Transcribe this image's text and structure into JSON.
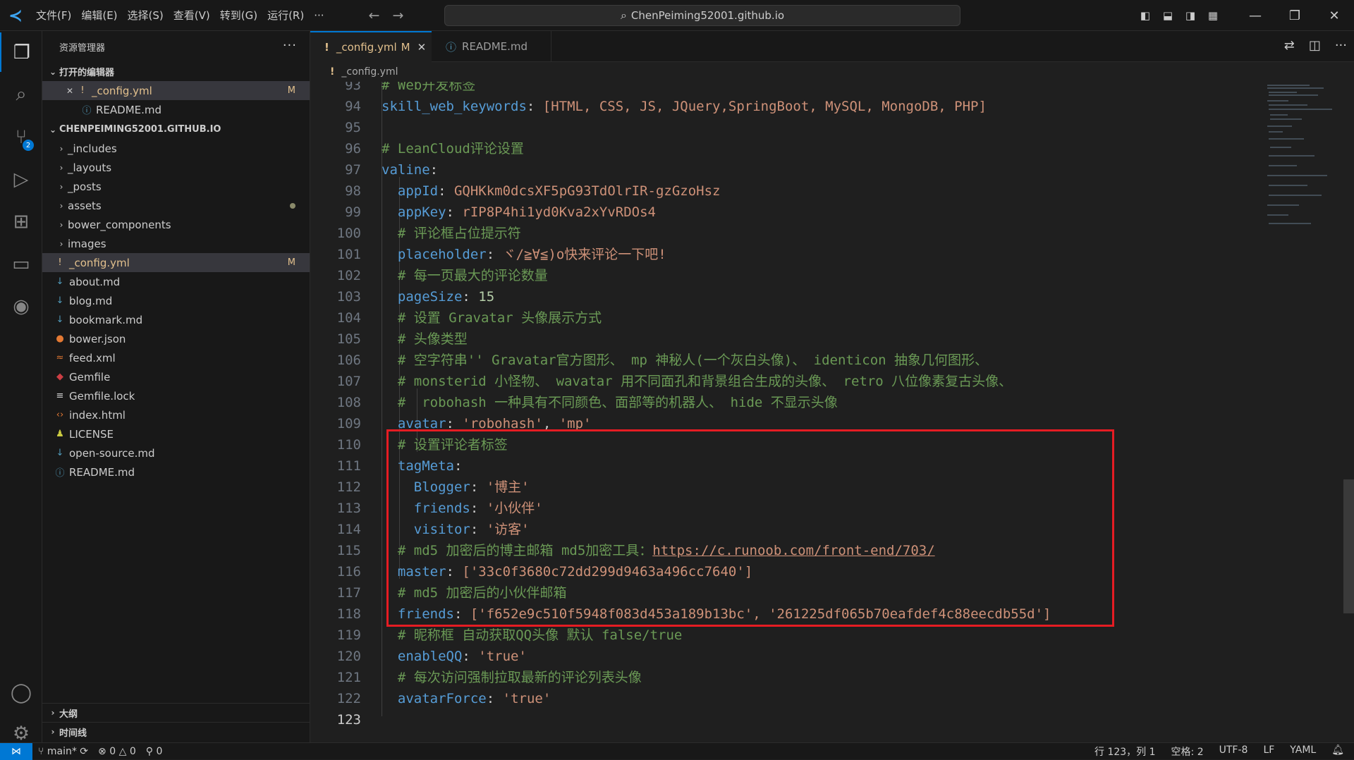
{
  "menu": [
    "文件(F)",
    "编辑(E)",
    "选择(S)",
    "查看(V)",
    "转到(G)",
    "运行(R)",
    "···"
  ],
  "search": {
    "text": "ChenPeiming52001.github.io"
  },
  "sidebar": {
    "title": "资源管理器",
    "open_editors_header": "打开的编辑器",
    "open_editors": [
      {
        "name": "_config.yml",
        "badge": "M"
      },
      {
        "name": "README.md"
      }
    ],
    "workspace_header": "CHENPEIMING52001.GITHUB.IO",
    "folders": [
      "_includes",
      "_layouts",
      "_posts",
      "assets",
      "bower_components",
      "images"
    ],
    "files": [
      {
        "name": "_config.yml",
        "badge": "M"
      },
      {
        "name": "about.md"
      },
      {
        "name": "blog.md"
      },
      {
        "name": "bookmark.md"
      },
      {
        "name": "bower.json"
      },
      {
        "name": "feed.xml"
      },
      {
        "name": "Gemfile"
      },
      {
        "name": "Gemfile.lock"
      },
      {
        "name": "index.html"
      },
      {
        "name": "LICENSE"
      },
      {
        "name": "open-source.md"
      },
      {
        "name": "README.md"
      }
    ],
    "outline": "大纲",
    "timeline": "时间线"
  },
  "tabs": [
    {
      "label": "_config.yml",
      "modified": "M"
    },
    {
      "label": "README.md"
    }
  ],
  "breadcrumb": "_config.yml",
  "code_lines": [
    {
      "n": "93",
      "segs": [
        [
          "c",
          "# Web开发标签"
        ]
      ]
    },
    {
      "n": "94",
      "segs": [
        [
          "k",
          "skill_web_keywords"
        ],
        [
          "p",
          ": "
        ],
        [
          "s",
          "[HTML, CSS, JS, JQuery,SpringBoot, MySQL, MongoDB, PHP]"
        ]
      ]
    },
    {
      "n": "95",
      "segs": []
    },
    {
      "n": "96",
      "segs": [
        [
          "c",
          "# LeanCloud评论设置"
        ]
      ]
    },
    {
      "n": "97",
      "segs": [
        [
          "k",
          "valine"
        ],
        [
          "p",
          ":"
        ]
      ]
    },
    {
      "n": "98",
      "segs": [
        [
          "p",
          "  "
        ],
        [
          "k",
          "appId"
        ],
        [
          "p",
          ": "
        ],
        [
          "s",
          "GQHKkm0dcsXF5pG93TdOlrIR-gzGzoHsz"
        ]
      ]
    },
    {
      "n": "99",
      "segs": [
        [
          "p",
          "  "
        ],
        [
          "k",
          "appKey"
        ],
        [
          "p",
          ": "
        ],
        [
          "s",
          "rIP8P4hi1yd0Kva2xYvRDOs4"
        ]
      ]
    },
    {
      "n": "100",
      "segs": [
        [
          "p",
          "  "
        ],
        [
          "c",
          "# 评论框占位提示符"
        ]
      ]
    },
    {
      "n": "101",
      "segs": [
        [
          "p",
          "  "
        ],
        [
          "k",
          "placeholder"
        ],
        [
          "p",
          ": "
        ],
        [
          "s",
          "ヾ/≧∀≦)o快来评论一下吧!"
        ]
      ]
    },
    {
      "n": "102",
      "segs": [
        [
          "p",
          "  "
        ],
        [
          "c",
          "# 每一页最大的评论数量"
        ]
      ]
    },
    {
      "n": "103",
      "segs": [
        [
          "p",
          "  "
        ],
        [
          "k",
          "pageSize"
        ],
        [
          "p",
          ": "
        ],
        [
          "n",
          "15"
        ]
      ]
    },
    {
      "n": "104",
      "segs": [
        [
          "p",
          "  "
        ],
        [
          "c",
          "# 设置 Gravatar 头像展示方式"
        ]
      ]
    },
    {
      "n": "105",
      "segs": [
        [
          "p",
          "  "
        ],
        [
          "c",
          "# 头像类型"
        ]
      ]
    },
    {
      "n": "106",
      "segs": [
        [
          "p",
          "  "
        ],
        [
          "c",
          "# 空字符串'' Gravatar官方图形、 mp 神秘人(一个灰白头像)、 identicon 抽象几何图形、"
        ]
      ]
    },
    {
      "n": "107",
      "segs": [
        [
          "p",
          "  "
        ],
        [
          "c",
          "# monsterid 小怪物、 wavatar 用不同面孔和背景组合生成的头像、 retro 八位像素复古头像、"
        ]
      ]
    },
    {
      "n": "108",
      "segs": [
        [
          "p",
          "  "
        ],
        [
          "c",
          "#  robohash 一种具有不同颜色、面部等的机器人、 hide 不显示头像"
        ]
      ]
    },
    {
      "n": "109",
      "segs": [
        [
          "p",
          "  "
        ],
        [
          "k",
          "avatar"
        ],
        [
          "p",
          ": "
        ],
        [
          "s",
          "'robohash'"
        ],
        [
          "p",
          ", "
        ],
        [
          "s",
          "'mp'"
        ]
      ]
    },
    {
      "n": "110",
      "segs": [
        [
          "p",
          "  "
        ],
        [
          "c",
          "# 设置评论者标签"
        ]
      ]
    },
    {
      "n": "111",
      "segs": [
        [
          "p",
          "  "
        ],
        [
          "k",
          "tagMeta"
        ],
        [
          "p",
          ":"
        ]
      ]
    },
    {
      "n": "112",
      "segs": [
        [
          "p",
          "    "
        ],
        [
          "k",
          "Blogger"
        ],
        [
          "p",
          ": "
        ],
        [
          "s",
          "'博主'"
        ]
      ]
    },
    {
      "n": "113",
      "segs": [
        [
          "p",
          "    "
        ],
        [
          "k",
          "friends"
        ],
        [
          "p",
          ": "
        ],
        [
          "s",
          "'小伙伴'"
        ]
      ]
    },
    {
      "n": "114",
      "segs": [
        [
          "p",
          "    "
        ],
        [
          "k",
          "visitor"
        ],
        [
          "p",
          ": "
        ],
        [
          "s",
          "'访客'"
        ]
      ]
    },
    {
      "n": "115",
      "segs": [
        [
          "p",
          "  "
        ],
        [
          "c",
          "# md5 加密后的博主邮箱 md5加密工具："
        ],
        [
          "u",
          "https://c.runoob.com/front-end/703/"
        ]
      ]
    },
    {
      "n": "116",
      "segs": [
        [
          "p",
          "  "
        ],
        [
          "k",
          "master"
        ],
        [
          "p",
          ": "
        ],
        [
          "s",
          "['33c0f3680c72dd299d9463a496cc7640']"
        ]
      ]
    },
    {
      "n": "117",
      "segs": [
        [
          "p",
          "  "
        ],
        [
          "c",
          "# md5 加密后的小伙伴邮箱"
        ]
      ]
    },
    {
      "n": "118",
      "segs": [
        [
          "p",
          "  "
        ],
        [
          "k",
          "friends"
        ],
        [
          "p",
          ": "
        ],
        [
          "s",
          "['f652e9c510f5948f083d453a189b13bc', '261225df065b70eafdef4c88eecdb55d']"
        ]
      ]
    },
    {
      "n": "119",
      "segs": [
        [
          "p",
          "  "
        ],
        [
          "c",
          "# 昵称框 自动获取QQ头像 默认 false/true"
        ]
      ]
    },
    {
      "n": "120",
      "segs": [
        [
          "p",
          "  "
        ],
        [
          "k",
          "enableQQ"
        ],
        [
          "p",
          ": "
        ],
        [
          "s",
          "'true'"
        ]
      ]
    },
    {
      "n": "121",
      "segs": [
        [
          "p",
          "  "
        ],
        [
          "c",
          "# 每次访问强制拉取最新的评论列表头像"
        ]
      ]
    },
    {
      "n": "122",
      "segs": [
        [
          "p",
          "  "
        ],
        [
          "k",
          "avatarForce"
        ],
        [
          "p",
          ": "
        ],
        [
          "s",
          "'true'"
        ]
      ]
    },
    {
      "n": "123",
      "segs": []
    }
  ],
  "status": {
    "branch": "main*",
    "errors": "0",
    "warnings": "0",
    "ports": "0",
    "position": "行 123，列 1",
    "spaces": "空格: 2",
    "encoding": "UTF-8",
    "eol": "LF",
    "language": "YAML"
  }
}
